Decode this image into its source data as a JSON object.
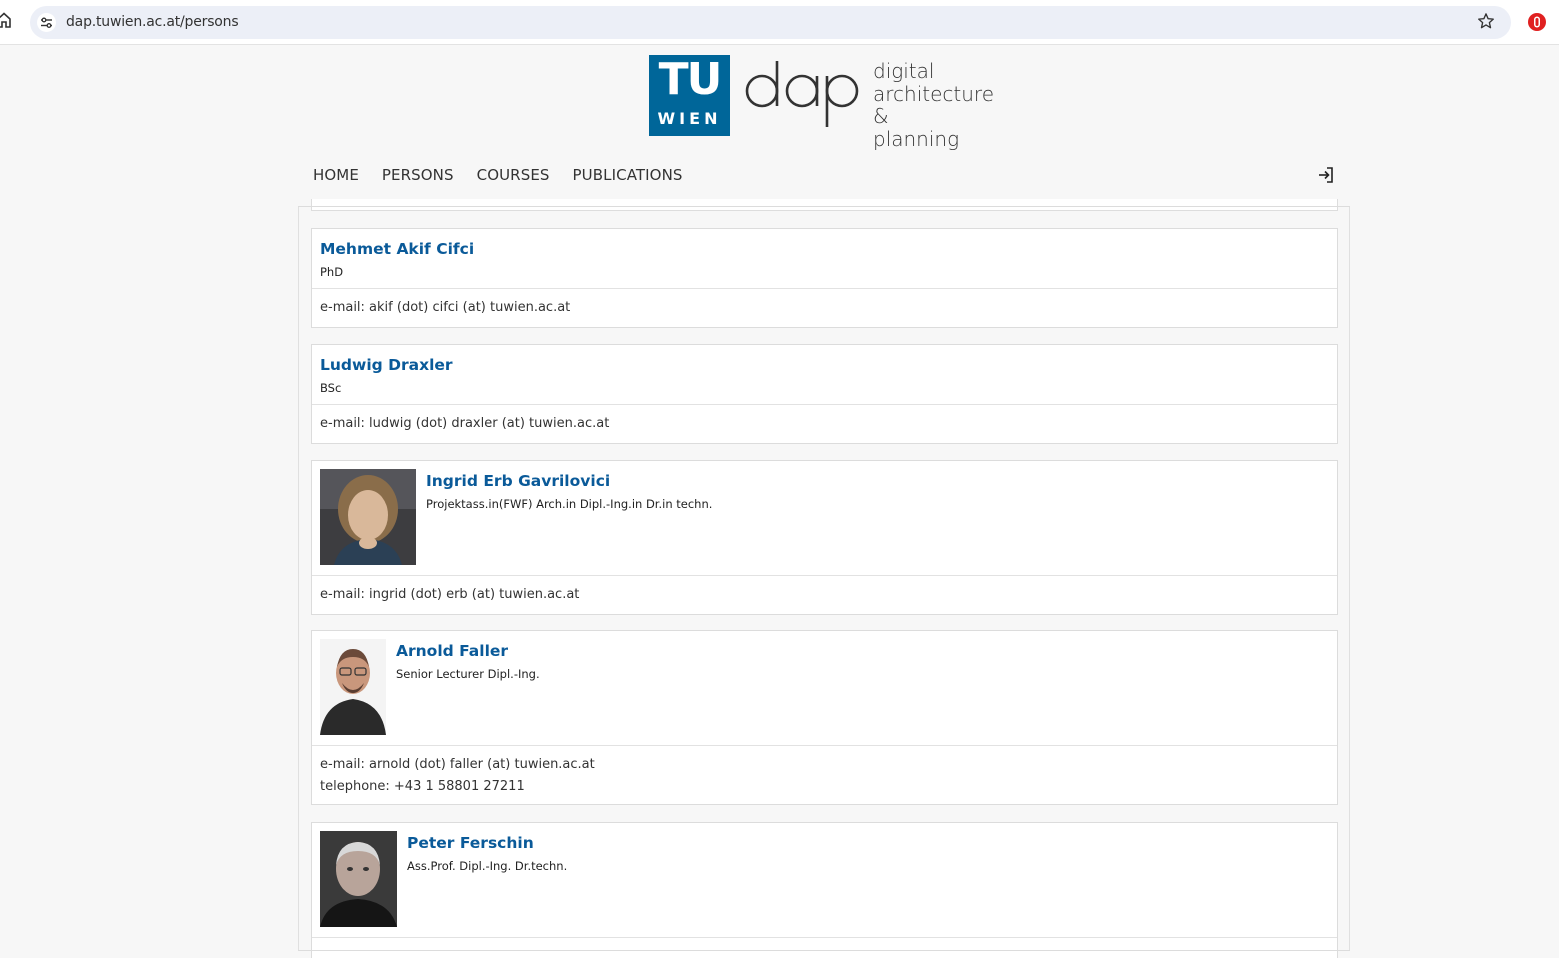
{
  "browser": {
    "url": "dap.tuwien.ac.at/persons"
  },
  "header": {
    "tu_logo_top": "TU",
    "tu_logo_bottom": "WIEN",
    "dap_mark": "dap",
    "tagline_line1": "digital",
    "tagline_line2": "architecture &",
    "tagline_line3": "planning"
  },
  "nav": {
    "items": [
      {
        "label": "HOME"
      },
      {
        "label": "PERSONS"
      },
      {
        "label": "COURSES"
      },
      {
        "label": "PUBLICATIONS"
      }
    ]
  },
  "persons": [
    {
      "name": "Mehmet Akif Cifci",
      "title": "PhD",
      "email": "e-mail: akif (dot) cifci (at) tuwien.ac.at",
      "telephone": ""
    },
    {
      "name": "Ludwig Draxler",
      "title": "BSc",
      "email": "e-mail: ludwig (dot) draxler (at) tuwien.ac.at",
      "telephone": ""
    },
    {
      "name": "Ingrid Erb Gavrilovici",
      "title": "Projektass.in(FWF) Arch.in Dipl.-Ing.in Dr.in techn.",
      "email": "e-mail: ingrid (dot) erb (at) tuwien.ac.at",
      "telephone": ""
    },
    {
      "name": "Arnold Faller",
      "title": "Senior Lecturer Dipl.-Ing.",
      "email": "e-mail: arnold (dot) faller (at) tuwien.ac.at",
      "telephone": "telephone: +43 1 58801 27211"
    },
    {
      "name": "Peter Ferschin",
      "title": "Ass.Prof. Dipl.-Ing. Dr.techn.",
      "email": "",
      "telephone": ""
    }
  ]
}
